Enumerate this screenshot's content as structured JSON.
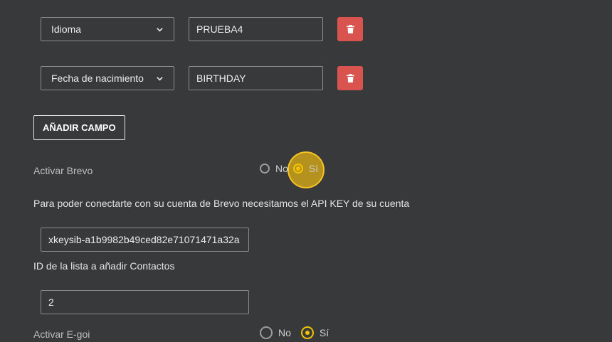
{
  "fields": [
    {
      "select_value": "Idioma",
      "input_value": "PRUEBA4"
    },
    {
      "select_value": "Fecha de nacimiento",
      "input_value": "BIRTHDAY"
    }
  ],
  "add_field_label": "AÑADIR CAMPO",
  "brevo": {
    "activate_label": "Activar Brevo",
    "option_no": "No",
    "option_yes": "Sí",
    "selected": "yes",
    "api_help_text": "Para poder conectarte con su cuenta de Brevo necesitamos el API KEY de su cuenta",
    "api_key_value": "xkeysib-a1b9982b49ced82e71071471a32a",
    "list_id_label": "ID de la lista a añadir Contactos",
    "list_id_value": "2"
  },
  "egoi": {
    "activate_label": "Activar E-goi",
    "option_no": "No",
    "option_yes": "Sí",
    "selected": "yes"
  },
  "colors": {
    "background": "#37393b",
    "delete_button": "#d9534f",
    "radio_accent": "#f3c300"
  },
  "icons": {
    "delete": "trash-icon",
    "select": "chevron-down-icon"
  }
}
